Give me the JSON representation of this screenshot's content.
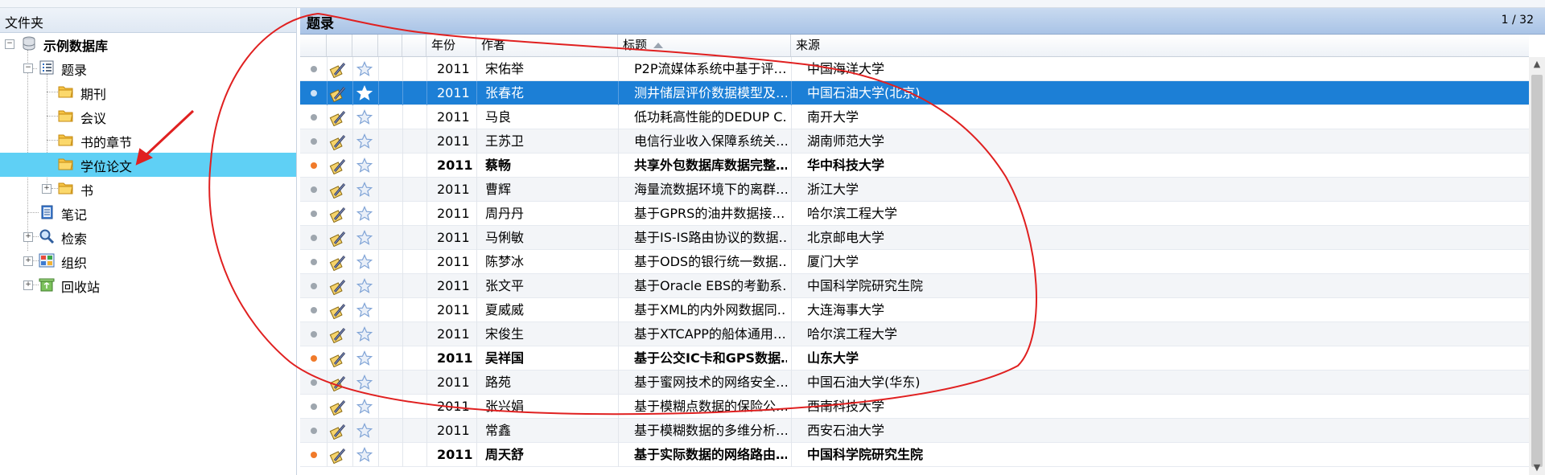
{
  "sidebar": {
    "header": "文件夹",
    "items": [
      {
        "label": "示例数据库",
        "icon": "database-icon"
      },
      {
        "label": "题录",
        "icon": "list-icon"
      },
      {
        "label": "期刊",
        "icon": "folder-icon"
      },
      {
        "label": "会议",
        "icon": "folder-icon"
      },
      {
        "label": "书的章节",
        "icon": "folder-icon"
      },
      {
        "label": "学位论文",
        "icon": "folder-icon"
      },
      {
        "label": "书",
        "icon": "folder-icon"
      },
      {
        "label": "笔记",
        "icon": "notebook-icon"
      },
      {
        "label": "检索",
        "icon": "magnifier-icon"
      },
      {
        "label": "组织",
        "icon": "grid-icon"
      },
      {
        "label": "回收站",
        "icon": "recycle-bin-icon"
      }
    ],
    "selected": "学位论文"
  },
  "list": {
    "title": "题录",
    "pager": "1 / 32",
    "columns": {
      "year": "年份",
      "author": "作者",
      "title": "标题",
      "source": "来源"
    },
    "rows": [
      {
        "year": "2011",
        "author": "宋佑举",
        "title": "P2P流媒体系统中基于评…",
        "source": "中国海洋大学",
        "unread": false,
        "selected": false
      },
      {
        "year": "2011",
        "author": "张春花",
        "title": "测井储层评价数据模型及…",
        "source": "中国石油大学(北京)",
        "unread": false,
        "selected": true
      },
      {
        "year": "2011",
        "author": "马良",
        "title": "低功耗高性能的DEDUP C…",
        "source": "南开大学",
        "unread": false,
        "selected": false
      },
      {
        "year": "2011",
        "author": "王苏卫",
        "title": "电信行业收入保障系统关…",
        "source": "湖南师范大学",
        "unread": false,
        "selected": false
      },
      {
        "year": "2011",
        "author": "蔡畅",
        "title": "共享外包数据库数据完整…",
        "source": "华中科技大学",
        "unread": true,
        "selected": false
      },
      {
        "year": "2011",
        "author": "曹辉",
        "title": "海量流数据环境下的离群…",
        "source": "浙江大学",
        "unread": false,
        "selected": false
      },
      {
        "year": "2011",
        "author": "周丹丹",
        "title": "基于GPRS的油井数据接…",
        "source": "哈尔滨工程大学",
        "unread": false,
        "selected": false
      },
      {
        "year": "2011",
        "author": "马俐敏",
        "title": "基于IS-IS路由协议的数据…",
        "source": "北京邮电大学",
        "unread": false,
        "selected": false
      },
      {
        "year": "2011",
        "author": "陈梦冰",
        "title": "基于ODS的银行统一数据…",
        "source": "厦门大学",
        "unread": false,
        "selected": false
      },
      {
        "year": "2011",
        "author": "张文平",
        "title": "基于Oracle EBS的考勤系…",
        "source": "中国科学院研究生院",
        "unread": false,
        "selected": false
      },
      {
        "year": "2011",
        "author": "夏威威",
        "title": "基于XML的内外网数据同…",
        "source": "大连海事大学",
        "unread": false,
        "selected": false
      },
      {
        "year": "2011",
        "author": "宋俊生",
        "title": "基于XTCAPP的船体通用…",
        "source": "哈尔滨工程大学",
        "unread": false,
        "selected": false
      },
      {
        "year": "2011",
        "author": "吴祥国",
        "title": "基于公交IC卡和GPS数据…",
        "source": "山东大学",
        "unread": true,
        "selected": false
      },
      {
        "year": "2011",
        "author": "路苑",
        "title": "基于蜜网技术的网络安全…",
        "source": "中国石油大学(华东)",
        "unread": false,
        "selected": false
      },
      {
        "year": "2011",
        "author": "张兴娟",
        "title": "基于模糊点数据的保险公…",
        "source": "西南科技大学",
        "unread": false,
        "selected": false
      },
      {
        "year": "2011",
        "author": "常鑫",
        "title": "基于模糊数据的多维分析…",
        "source": "西安石油大学",
        "unread": false,
        "selected": false
      },
      {
        "year": "2011",
        "author": "周天舒",
        "title": "基于实际数据的网络路由…",
        "source": "中国科学院研究生院",
        "unread": true,
        "selected": false
      }
    ]
  },
  "colors": {
    "selection_blue": "#1c7fd6",
    "tree_selection": "#5fd0f5",
    "unread_dot": "#f07a2a",
    "annotation_red": "#e02020"
  }
}
